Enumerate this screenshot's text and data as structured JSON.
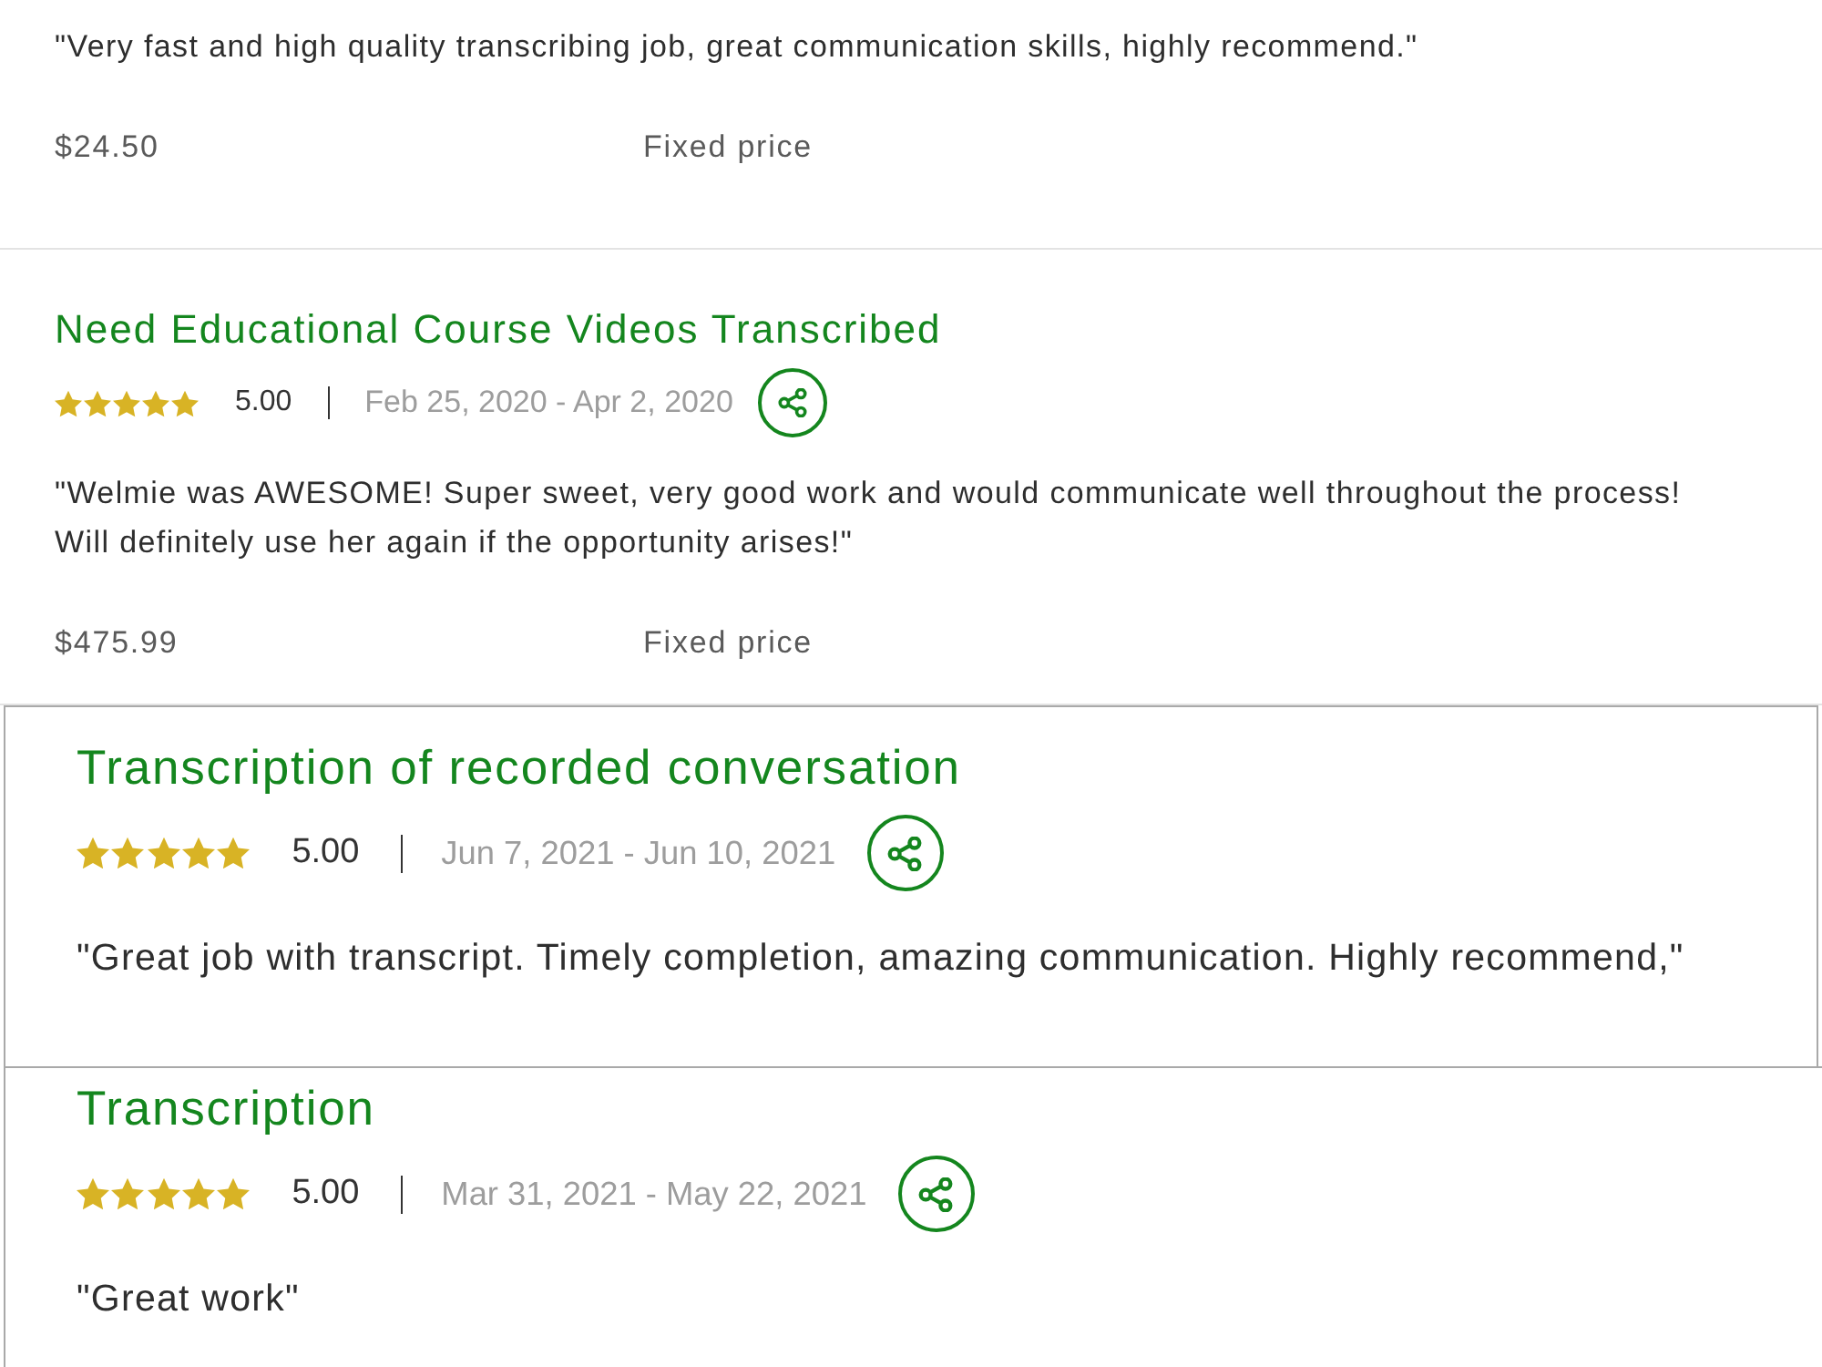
{
  "reviews": [
    {
      "kind": "plain",
      "quote": "\"Very fast and high quality transcribing job, great communication skills, highly recommend.\"",
      "price": "$24.50",
      "price_type": "Fixed price"
    },
    {
      "kind": "plain",
      "title": "Need Educational Course Videos Transcribed",
      "stars": 5,
      "rating": "5.00",
      "dates": "Feb 25, 2020 - Apr 2, 2020",
      "quote": "\"Welmie was AWESOME! Super sweet, very good work and would communicate well throughout the process! Will definitely use her again if the opportunity arises!\"",
      "price": "$475.99",
      "price_type": "Fixed price"
    },
    {
      "kind": "framed",
      "title": "Transcription of recorded conversation",
      "stars": 5,
      "rating": "5.00",
      "dates": "Jun 7, 2021 - Jun 10, 2021",
      "quote": "\"Great job with transcript. Timely completion, amazing communication. Highly recommend,\""
    },
    {
      "kind": "framed",
      "title": "Transcription",
      "stars": 5,
      "rating": "5.00",
      "dates": "Mar 31, 2021 - May 22, 2021",
      "quote": "\"Great work\""
    }
  ]
}
